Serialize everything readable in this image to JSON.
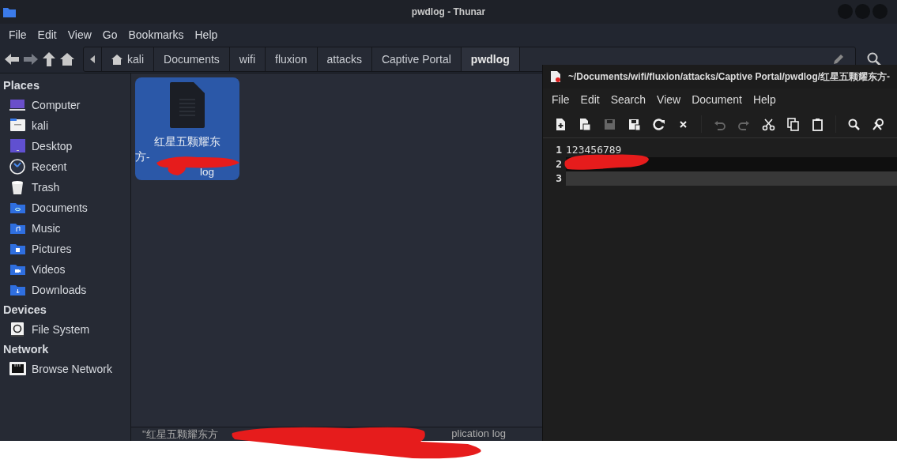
{
  "thunar": {
    "window_title": "pwdlog - Thunar",
    "menu": [
      "File",
      "Edit",
      "View",
      "Go",
      "Bookmarks",
      "Help"
    ],
    "path": [
      {
        "label": "kali",
        "kind": "home",
        "selected": false
      },
      {
        "label": "Documents",
        "kind": "folder",
        "selected": false
      },
      {
        "label": "wifi",
        "kind": "folder",
        "selected": false
      },
      {
        "label": "fluxion",
        "kind": "folder",
        "selected": false
      },
      {
        "label": "attacks",
        "kind": "folder",
        "selected": false
      },
      {
        "label": "Captive Portal",
        "kind": "folder",
        "selected": false
      },
      {
        "label": "pwdlog",
        "kind": "folder",
        "selected": true
      }
    ],
    "sidebar": [
      {
        "heading": "Places",
        "items": [
          {
            "label": "Computer",
            "kind": "computer"
          },
          {
            "label": "kali",
            "kind": "home"
          },
          {
            "label": "Desktop",
            "kind": "desktop"
          },
          {
            "label": "Recent",
            "kind": "recent"
          },
          {
            "label": "Trash",
            "kind": "trash"
          },
          {
            "label": "Documents",
            "kind": "documents"
          },
          {
            "label": "Music",
            "kind": "music"
          },
          {
            "label": "Pictures",
            "kind": "pictures"
          },
          {
            "label": "Videos",
            "kind": "videos"
          },
          {
            "label": "Downloads",
            "kind": "downloads"
          }
        ]
      },
      {
        "heading": "Devices",
        "items": [
          {
            "label": "File System",
            "kind": "drive"
          }
        ]
      },
      {
        "heading": "Network",
        "items": [
          {
            "label": "Browse Network",
            "kind": "network"
          }
        ]
      }
    ],
    "file": {
      "name_top": "红星五颗耀东",
      "name_middle": "方-",
      "name_bottom": "log",
      "selected": true
    },
    "status_bar": {
      "start": "\"红星五颗耀东方",
      "end": "plication log"
    }
  },
  "editor": {
    "title": "~/Documents/wifi/fluxion/attacks/Captive Portal/pwdlog/红星五颗耀东方-",
    "menu": [
      "File",
      "Edit",
      "Search",
      "View",
      "Document",
      "Help"
    ],
    "toolbar": [
      {
        "kind": "new",
        "disabled": false
      },
      {
        "kind": "open",
        "disabled": false
      },
      {
        "kind": "save",
        "disabled": true
      },
      {
        "kind": "save-as",
        "disabled": false
      },
      {
        "kind": "reload",
        "disabled": false
      },
      {
        "kind": "close",
        "disabled": false
      },
      {
        "kind": "sep"
      },
      {
        "kind": "undo",
        "disabled": true
      },
      {
        "kind": "redo",
        "disabled": true
      },
      {
        "kind": "cut",
        "disabled": false
      },
      {
        "kind": "copy",
        "disabled": false
      },
      {
        "kind": "paste",
        "disabled": false
      },
      {
        "kind": "sep"
      },
      {
        "kind": "search",
        "disabled": false
      },
      {
        "kind": "replace",
        "disabled": false
      }
    ],
    "lines": [
      {
        "number": "1",
        "text": "123456789",
        "kind": "plain"
      },
      {
        "number": "2",
        "kind": "current"
      },
      {
        "number": "3",
        "kind": "shaded"
      }
    ]
  }
}
